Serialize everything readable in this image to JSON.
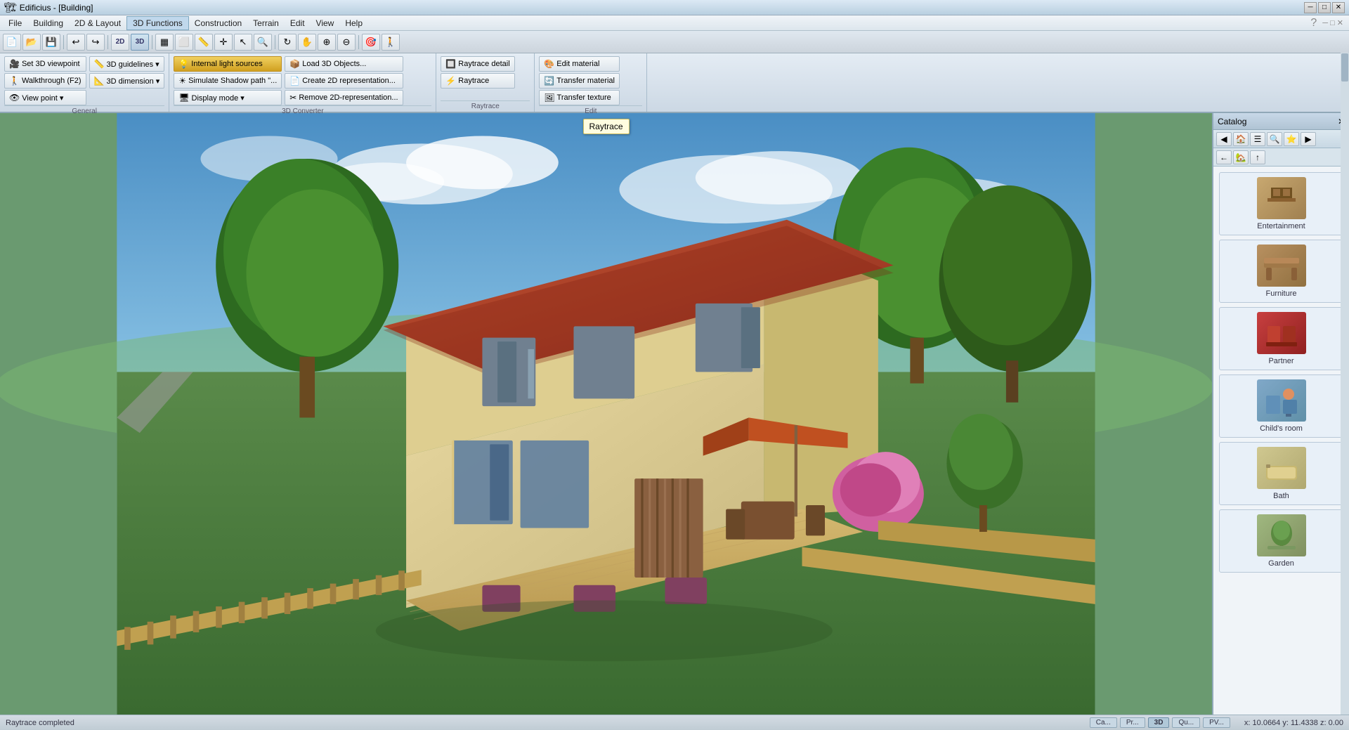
{
  "app": {
    "title": "Edificius - [Building]",
    "window_controls": [
      "minimize",
      "maximize",
      "close"
    ]
  },
  "titlebar": {
    "title": "Edificius"
  },
  "menubar": {
    "items": [
      "File",
      "Building",
      "2D & Layout",
      "3D Functions",
      "Construction",
      "Terrain",
      "Edit",
      "View",
      "Help"
    ]
  },
  "quick_toolbar": {
    "buttons": [
      "new",
      "open",
      "save",
      "undo",
      "redo",
      "2d",
      "3d",
      "wireframe",
      "shaded",
      "cursor",
      "zoom",
      "pan",
      "measure",
      "3d-rotate"
    ]
  },
  "ribbon": {
    "sections": [
      {
        "title": "General",
        "buttons": [
          {
            "label": "Set 3D viewpoint",
            "icon": "🎥"
          },
          {
            "label": "Walkthrough (F2)",
            "icon": "🚶"
          },
          {
            "label": "View point",
            "icon": "👁"
          },
          {
            "label": "View point",
            "icon": "👁"
          },
          {
            "label": "3D guidelines",
            "icon": "📏"
          },
          {
            "label": "3D dimension",
            "icon": "📐"
          }
        ]
      },
      {
        "title": "3D Converter",
        "buttons": [
          {
            "label": "Internal light sources",
            "icon": "💡",
            "active": true
          },
          {
            "label": "Simulate Shadow path...",
            "icon": "☀"
          },
          {
            "label": "Display mode",
            "icon": "🖥"
          },
          {
            "label": "Load 3D Objects...",
            "icon": "📦"
          },
          {
            "label": "Create 2D representation...",
            "icon": "📄"
          },
          {
            "label": "Remove 2D-representation...",
            "icon": "✂"
          }
        ]
      },
      {
        "title": "Raytrace",
        "buttons": [
          {
            "label": "Raytrace detail",
            "icon": "🔲"
          },
          {
            "label": "Raytrace",
            "icon": "⚡"
          }
        ]
      },
      {
        "title": "Edit",
        "buttons": [
          {
            "label": "Edit material",
            "icon": "🎨"
          },
          {
            "label": "Transfer material",
            "icon": "🔄"
          },
          {
            "label": "Transfer texture",
            "icon": "🖼"
          }
        ]
      }
    ]
  },
  "viewport": {
    "tooltip": "Raytrace"
  },
  "catalog": {
    "title": "Catalog",
    "items": [
      {
        "id": "entertainment",
        "label": "Entertainment",
        "thumb_class": "thumb-entertainment",
        "icon": "🎵"
      },
      {
        "id": "furniture",
        "label": "Furniture",
        "thumb_class": "thumb-furniture",
        "icon": "🪑"
      },
      {
        "id": "partner",
        "label": "Partner",
        "thumb_class": "thumb-partner",
        "icon": "🪑"
      },
      {
        "id": "child-room",
        "label": "Child's room",
        "thumb_class": "thumb-child",
        "icon": "🧸"
      },
      {
        "id": "bath",
        "label": "Bath",
        "thumb_class": "thumb-bath",
        "icon": "🛁"
      },
      {
        "id": "garden",
        "label": "Garden",
        "thumb_class": "thumb-garden",
        "icon": "🌿"
      }
    ]
  },
  "statusbar": {
    "status": "Raytrace completed",
    "tabs": [
      "Ca...",
      "Pr...",
      "3D",
      "Qu...",
      "PV..."
    ],
    "coords": "x: 10.0664    y: 11.4338    z: 0.00"
  }
}
